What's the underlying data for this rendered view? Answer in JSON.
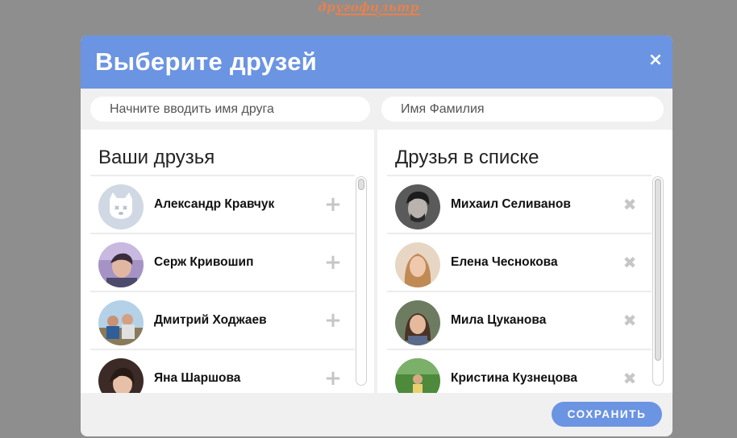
{
  "brand": {
    "name": "другофильтр"
  },
  "modal": {
    "title": "Выберите друзей",
    "close_icon": "×",
    "search_friend_placeholder": "Начните вводить имя друга",
    "search_name_placeholder": "Имя Фамилия",
    "save_label": "СОХРАНИТЬ"
  },
  "your_friends": {
    "title": "Ваши друзья",
    "action_icon": "+",
    "items": [
      {
        "name": "Александр Кравчук",
        "avatar": "default-dog-avatar"
      },
      {
        "name": "Серж Кривошип",
        "avatar": "photo-avatar"
      },
      {
        "name": "Дмитрий Ходжаев",
        "avatar": "photo-avatar"
      },
      {
        "name": "Яна Шаршова",
        "avatar": "photo-avatar"
      }
    ]
  },
  "list_friends": {
    "title": "Друзья в списке",
    "action_icon": "✖",
    "items": [
      {
        "name": "Михаил Селиванов",
        "avatar": "photo-avatar"
      },
      {
        "name": "Елена Чеснокова",
        "avatar": "photo-avatar"
      },
      {
        "name": "Мила Цуканова",
        "avatar": "photo-avatar"
      },
      {
        "name": "Кристина Кузнецова",
        "avatar": "photo-avatar"
      }
    ]
  },
  "colors": {
    "header": "#6b94e2",
    "backdrop": "#8e8e8e",
    "brand": "#e8804e",
    "action_icon": "#c6c6c6"
  }
}
